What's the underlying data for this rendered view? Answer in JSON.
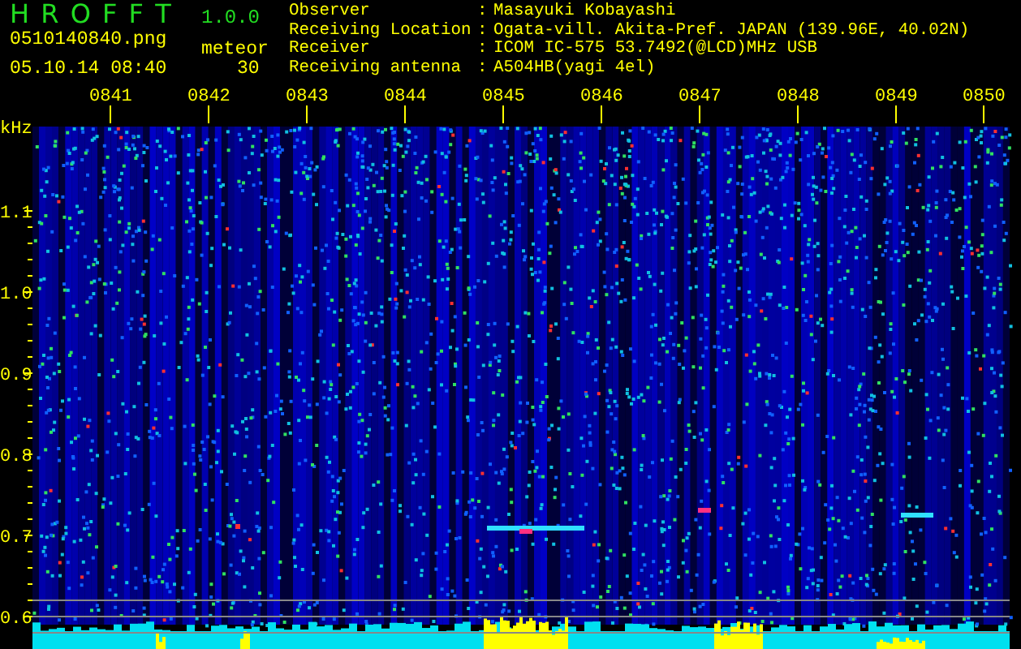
{
  "header": {
    "title": "H R O F F T",
    "version": "1.0.0",
    "filename": "0510140840.png",
    "datetime": "05.10.14 08:40",
    "counter_label": "meteor",
    "counter_value": "30"
  },
  "station": [
    {
      "label": "Observer",
      "separator": ":",
      "value": "Masayuki Kobayashi"
    },
    {
      "label": "Receiving Location",
      "separator": ":",
      "value": "Ogata-vill. Akita-Pref. JAPAN (139.96E, 40.02N)"
    },
    {
      "label": "Receiver",
      "separator": ":",
      "value": "ICOM IC-575 53.7492(@LCD)MHz USB"
    },
    {
      "label": "Receiving antenna",
      "separator": ":",
      "value": "A504HB(yagi 4el)"
    }
  ],
  "spectrogram": {
    "unit": "kHz",
    "frequency_labels": [
      "1.1",
      "1.0",
      "0.9",
      "0.8",
      "0.7",
      "0.6"
    ],
    "time_labels": [
      "0841",
      "0842",
      "0843",
      "0844",
      "0845",
      "0846",
      "0847",
      "0848",
      "0849",
      "0850"
    ]
  }
}
